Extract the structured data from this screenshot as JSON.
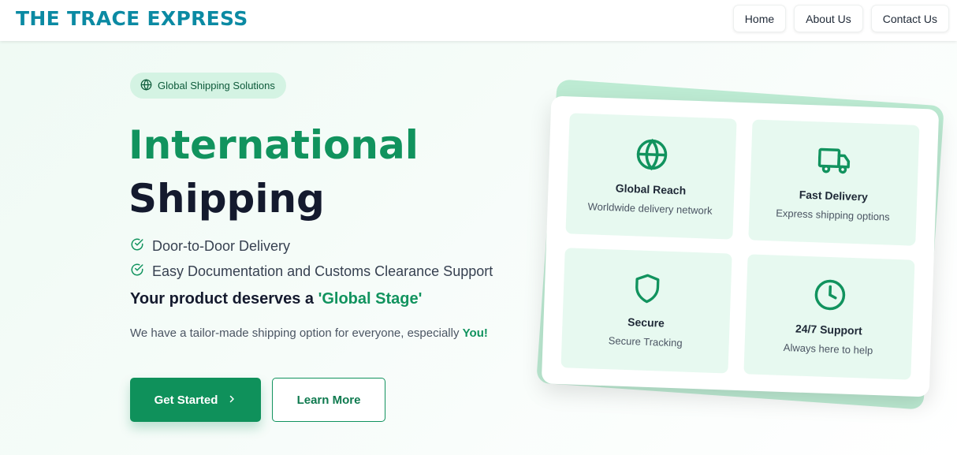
{
  "header": {
    "brand": "THE TRACE EXPRESS",
    "nav": [
      "Home",
      "About Us",
      "Contact Us"
    ]
  },
  "hero": {
    "badge": "Global Shipping Solutions",
    "title_line1": "International",
    "title_line2": "Shipping",
    "features": [
      "Door-to-Door Delivery",
      "Easy Documentation and Customs Clearance Support"
    ],
    "tagline_prefix": "Your product deserves a ",
    "tagline_highlight": "'Global Stage'",
    "desc_prefix": "We have a tailor-made shipping option for everyone, especially ",
    "desc_highlight": "You!",
    "primary_button": "Get Started",
    "secondary_button": "Learn More"
  },
  "services": [
    {
      "title": "Global Reach",
      "subtitle": "Worldwide delivery network",
      "icon": "globe-icon"
    },
    {
      "title": "Fast Delivery",
      "subtitle": "Express shipping options",
      "icon": "truck-icon"
    },
    {
      "title": "Secure",
      "subtitle": "Secure Tracking",
      "icon": "shield-icon"
    },
    {
      "title": "24/7 Support",
      "subtitle": "Always here to help",
      "icon": "clock-icon"
    }
  ],
  "colors": {
    "brand": "#0b8aa3",
    "accent": "#11935e",
    "heading": "#141a2e",
    "tile_bg": "#e7f9f0"
  }
}
